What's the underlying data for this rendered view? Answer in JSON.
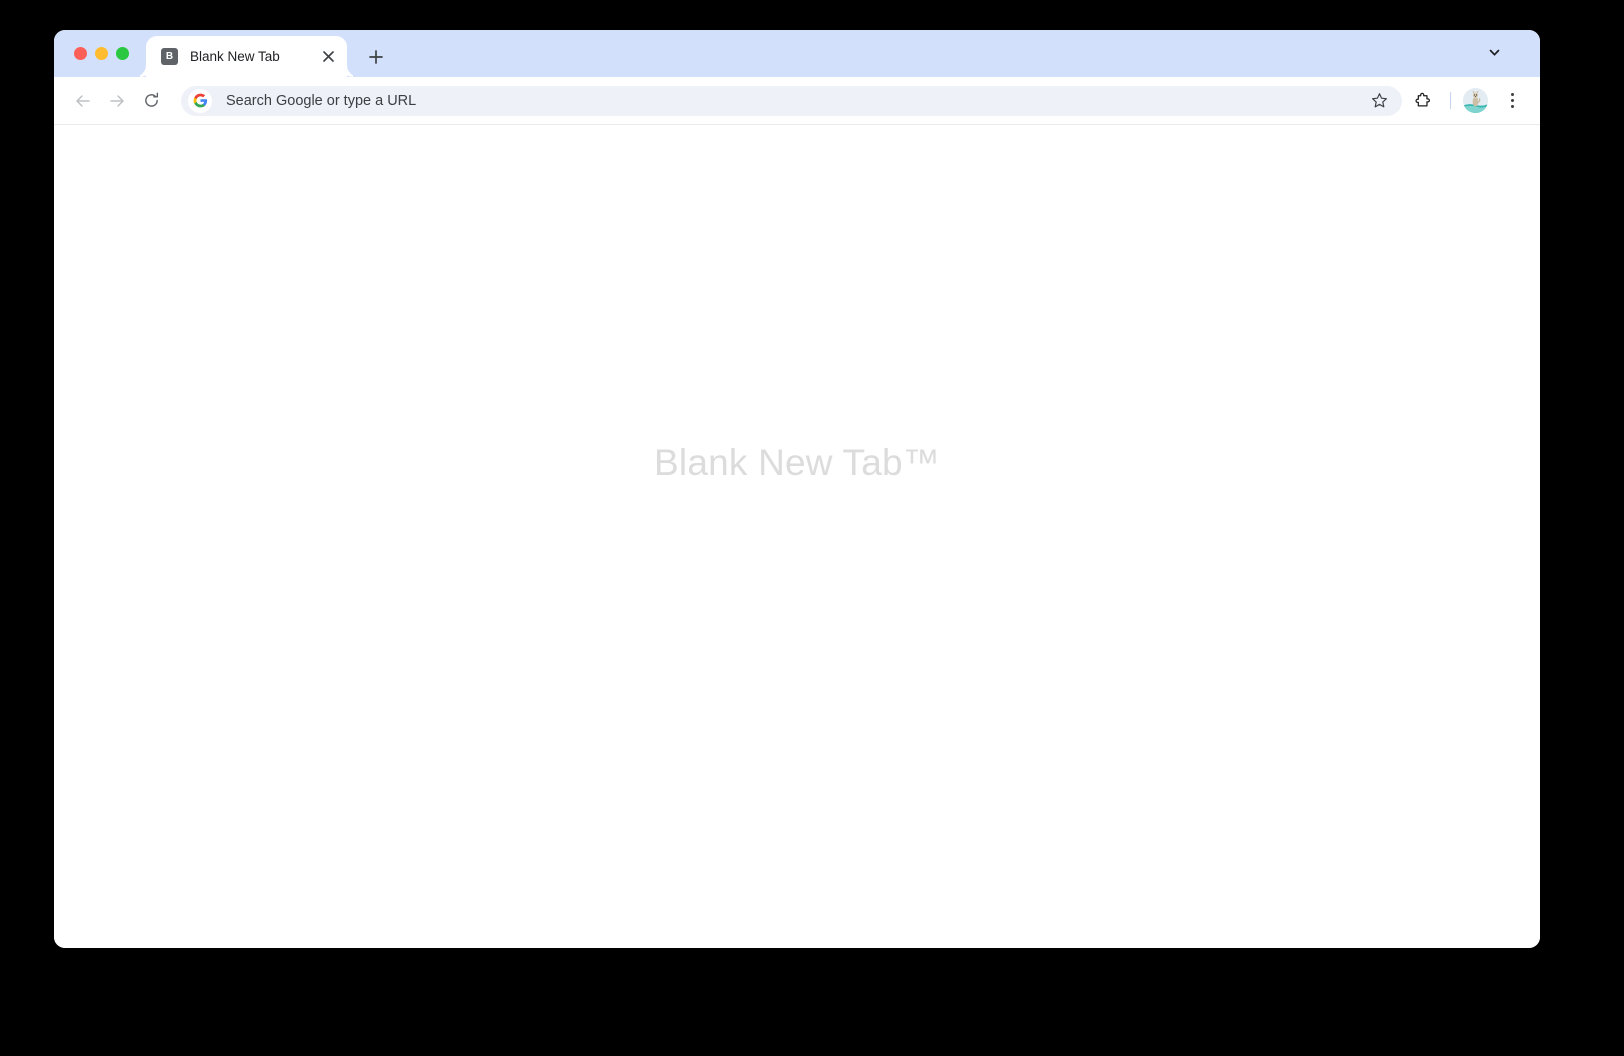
{
  "window": {
    "traffic_lights": [
      {
        "name": "close",
        "color": "#fb6058"
      },
      {
        "name": "minimize",
        "color": "#febc2e"
      },
      {
        "name": "maximize",
        "color": "#29c840"
      }
    ]
  },
  "tab_strip": {
    "background_color": "#d3e0fb",
    "tabs": [
      {
        "title": "Blank New Tab",
        "favicon_letter": "B",
        "favicon_color": "#5f6368",
        "active": true,
        "close_icon": "close-icon"
      }
    ],
    "new_tab_label": "+",
    "new_tab_icon": "plus-icon",
    "tab_search_icon": "chevron-down-icon"
  },
  "toolbar": {
    "back_icon": "arrow-left-icon",
    "back_enabled": false,
    "forward_icon": "arrow-right-icon",
    "forward_enabled": false,
    "reload_icon": "reload-icon",
    "omnibox": {
      "placeholder": "Search Google or type a URL",
      "value": "",
      "leading_icon": "google-g-icon",
      "background_color": "#eef1f8"
    },
    "bookmark_icon": "star-icon",
    "extensions_icon": "puzzle-piece-icon",
    "profile_icon": "avatar",
    "menu_icon": "three-dot-menu-icon"
  },
  "page": {
    "watermark": "Blank New Tab™",
    "watermark_color": "#dcdcdc",
    "background_color": "#ffffff"
  }
}
